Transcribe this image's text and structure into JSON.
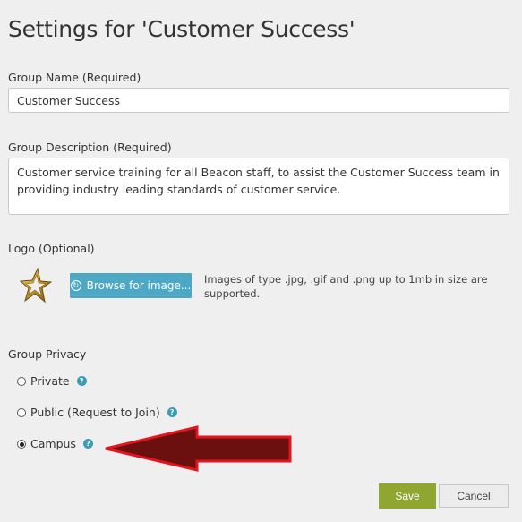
{
  "page": {
    "title": "Settings for 'Customer Success'"
  },
  "group_name": {
    "label": "Group Name (Required)",
    "value": "Customer Success"
  },
  "group_description": {
    "label": "Group Description (Required)",
    "value": "Customer service training for all Beacon staff, to assist the Customer Success team in providing industry leading standards of customer service."
  },
  "logo": {
    "label": "Logo (Optional)",
    "icon": "star-icon",
    "browse_label": "Browse for image...",
    "help_text": "Images of type .jpg, .gif and .png up to 1mb in size are supported."
  },
  "privacy": {
    "label": "Group Privacy",
    "selected": "Campus",
    "options": [
      {
        "label": "Private",
        "checked": false
      },
      {
        "label": "Public (Request to Join)",
        "checked": false
      },
      {
        "label": "Campus",
        "checked": true
      }
    ],
    "help_icon": "question-icon"
  },
  "actions": {
    "save_label": "Save",
    "cancel_label": "Cancel"
  },
  "annotation": {
    "arrow_color": "#e0161f",
    "arrow_fill": "#6b0f0f"
  }
}
